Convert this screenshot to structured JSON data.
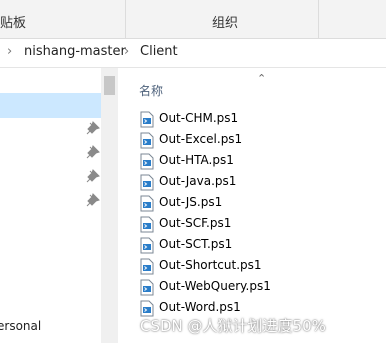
{
  "ribbon": {
    "top_partial": "× × × ×",
    "group_clipboard": "贴板",
    "group_organize": "组织"
  },
  "address": {
    "crumbs": [
      "nishang-master",
      "Client"
    ]
  },
  "nav": {
    "bottom_label": "ersonal"
  },
  "list": {
    "column_header": "名称",
    "files": [
      "Out-CHM.ps1",
      "Out-Excel.ps1",
      "Out-HTA.ps1",
      "Out-Java.ps1",
      "Out-JS.ps1",
      "Out-SCF.ps1",
      "Out-SCT.ps1",
      "Out-Shortcut.ps1",
      "Out-WebQuery.ps1",
      "Out-Word.ps1"
    ]
  },
  "watermark": "CSDN @人狱计划进度50%",
  "icons": {
    "pin": "pin-icon",
    "file": "powershell-script-icon",
    "chevron": "chevron-right-icon",
    "sort": "sort-ascending-icon"
  }
}
